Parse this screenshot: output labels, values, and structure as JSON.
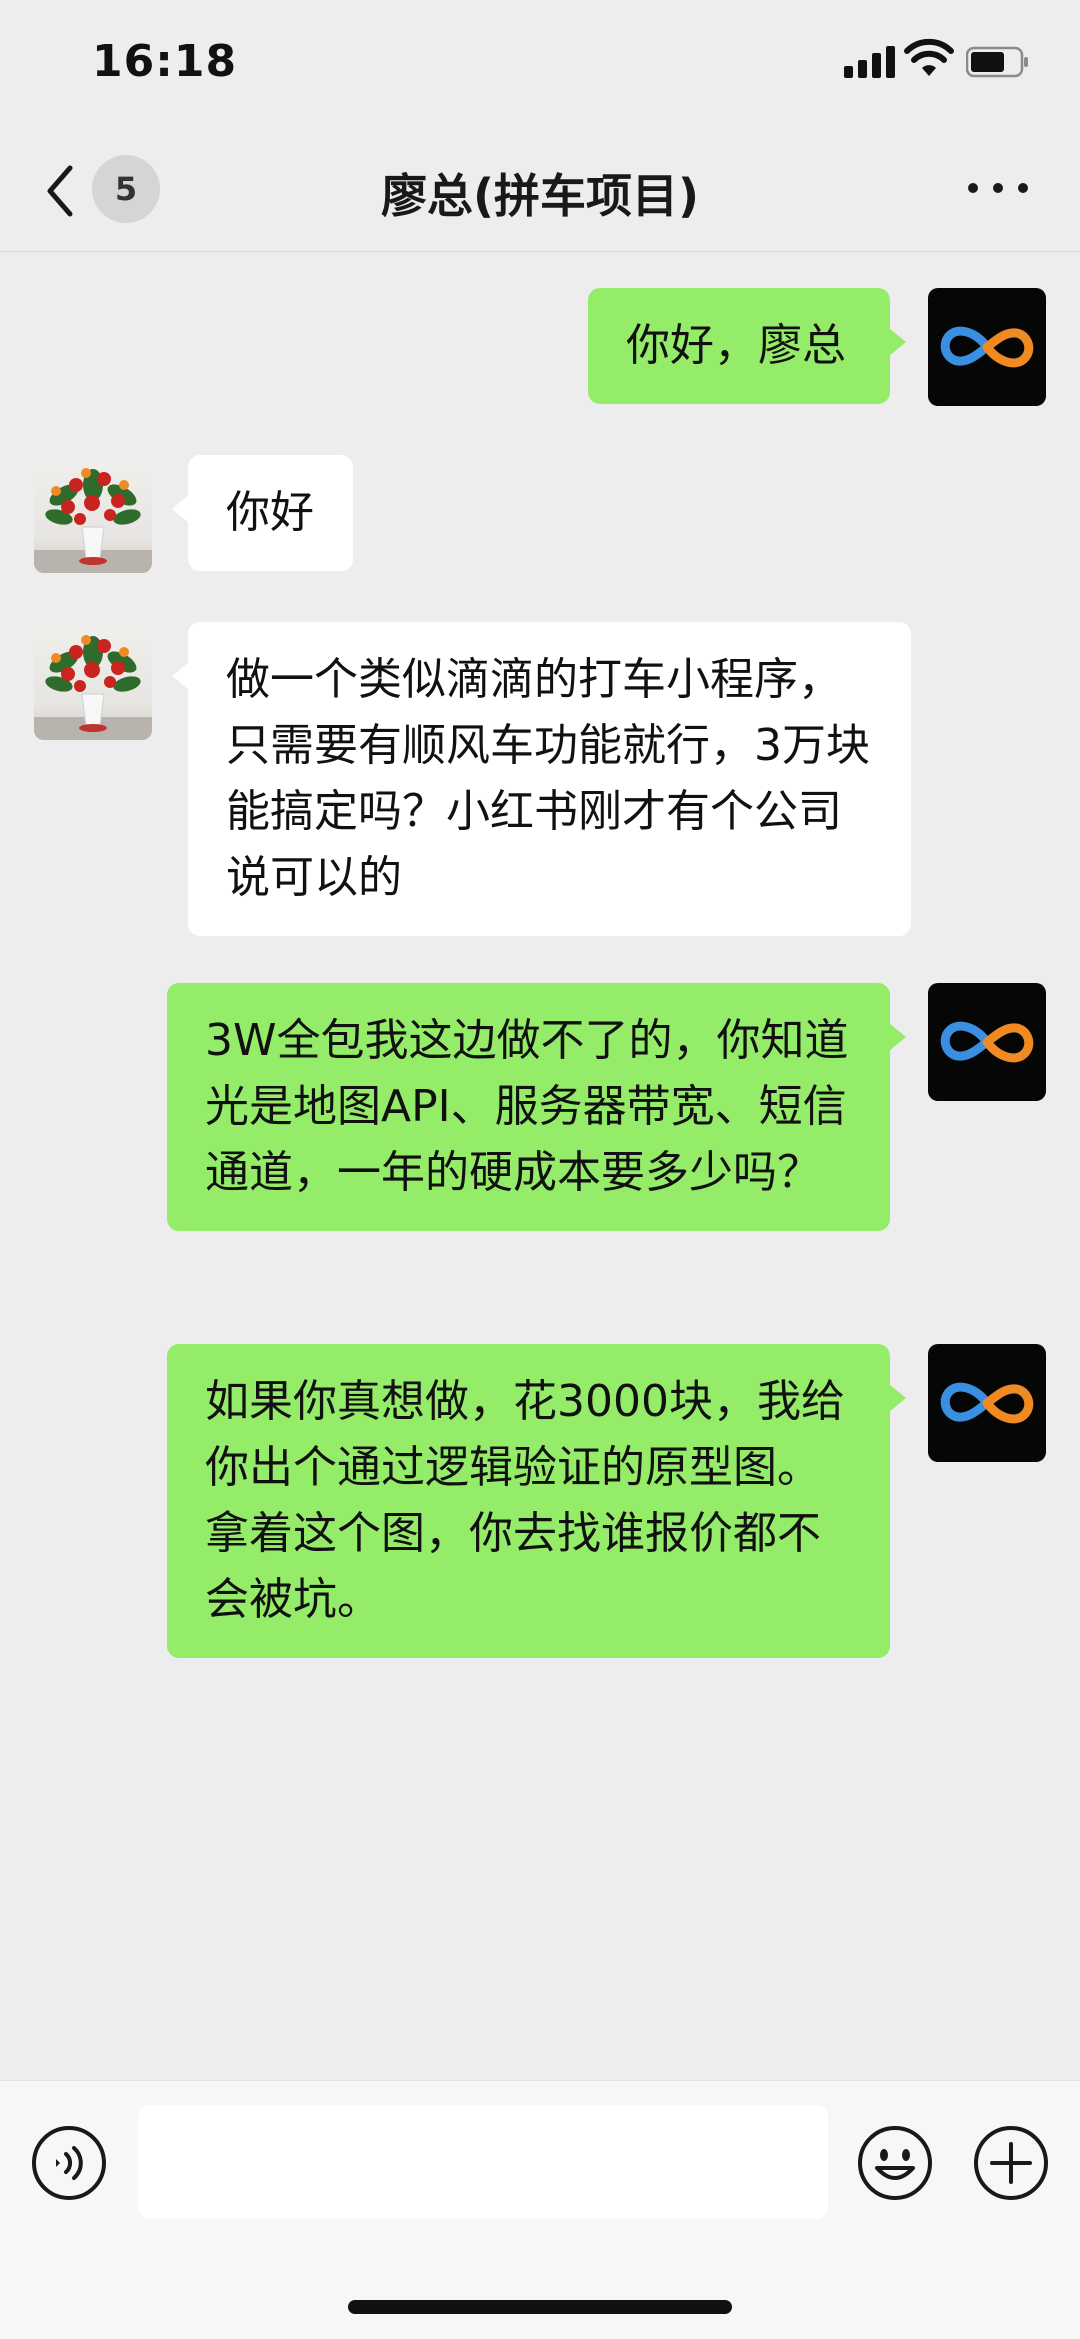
{
  "status_bar": {
    "time": "16:18"
  },
  "nav": {
    "unread_count": "5",
    "title": "廖总(拼车项目)"
  },
  "messages": [
    {
      "side": "out",
      "text": "你好，廖总"
    },
    {
      "side": "in",
      "text": "你好"
    },
    {
      "side": "in",
      "text": "做一个类似滴滴的打车小程序，只需要有顺风车功能就行，3万块能搞定吗？小红书刚才有个公司说可以的"
    },
    {
      "side": "out",
      "text": "3W全包我这边做不了的，你知道光是地图API、服务器带宽、短信通道，一年的硬成本要多少吗？"
    },
    {
      "side": "out",
      "text": "如果你真想做，花3000块，我给你出个通过逻辑验证的原型图。拿着这个图，你去找谁报价都不会被坑。"
    }
  ],
  "input": {
    "value": ""
  },
  "colors": {
    "outgoing_bubble": "#95ec69",
    "incoming_bubble": "#ffffff",
    "background": "#ededed"
  },
  "icons": [
    "back-chevron-icon",
    "more-icon",
    "voice-icon",
    "emoji-icon",
    "plus-icon",
    "infinity-logo-icon",
    "flower-vase-icon"
  ]
}
